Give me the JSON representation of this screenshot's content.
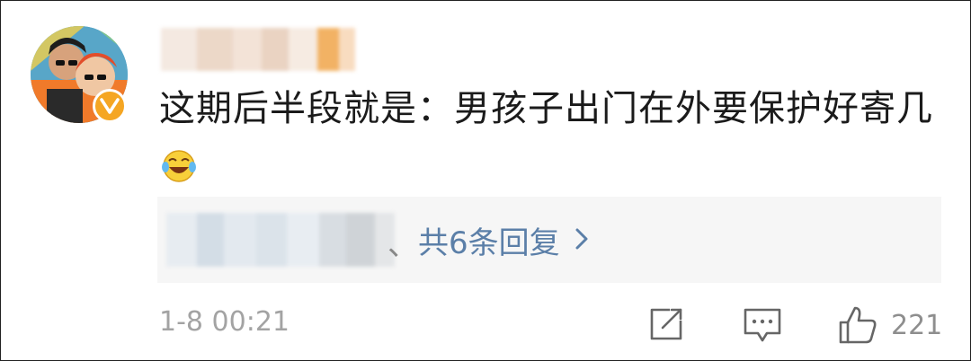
{
  "comment": {
    "username": "",
    "text": "这期后半段就是：男孩子出门在外要保护好寄几",
    "emoji": "laughing-crying-emoji",
    "timestamp": "1-8 00:21"
  },
  "replies": {
    "separator": "、",
    "link_label": "共6条回复",
    "chevron": "chevron-right-icon"
  },
  "actions": {
    "share_icon": "share-icon",
    "comment_icon": "comment-icon",
    "like_icon": "thumbs-up-icon",
    "like_count": "221"
  },
  "colors": {
    "text": "#1b1b1b",
    "link": "#5b7fa8",
    "muted": "#a3a3a3",
    "reply_bg": "#f6f6f6",
    "verified": "#f5a623"
  }
}
